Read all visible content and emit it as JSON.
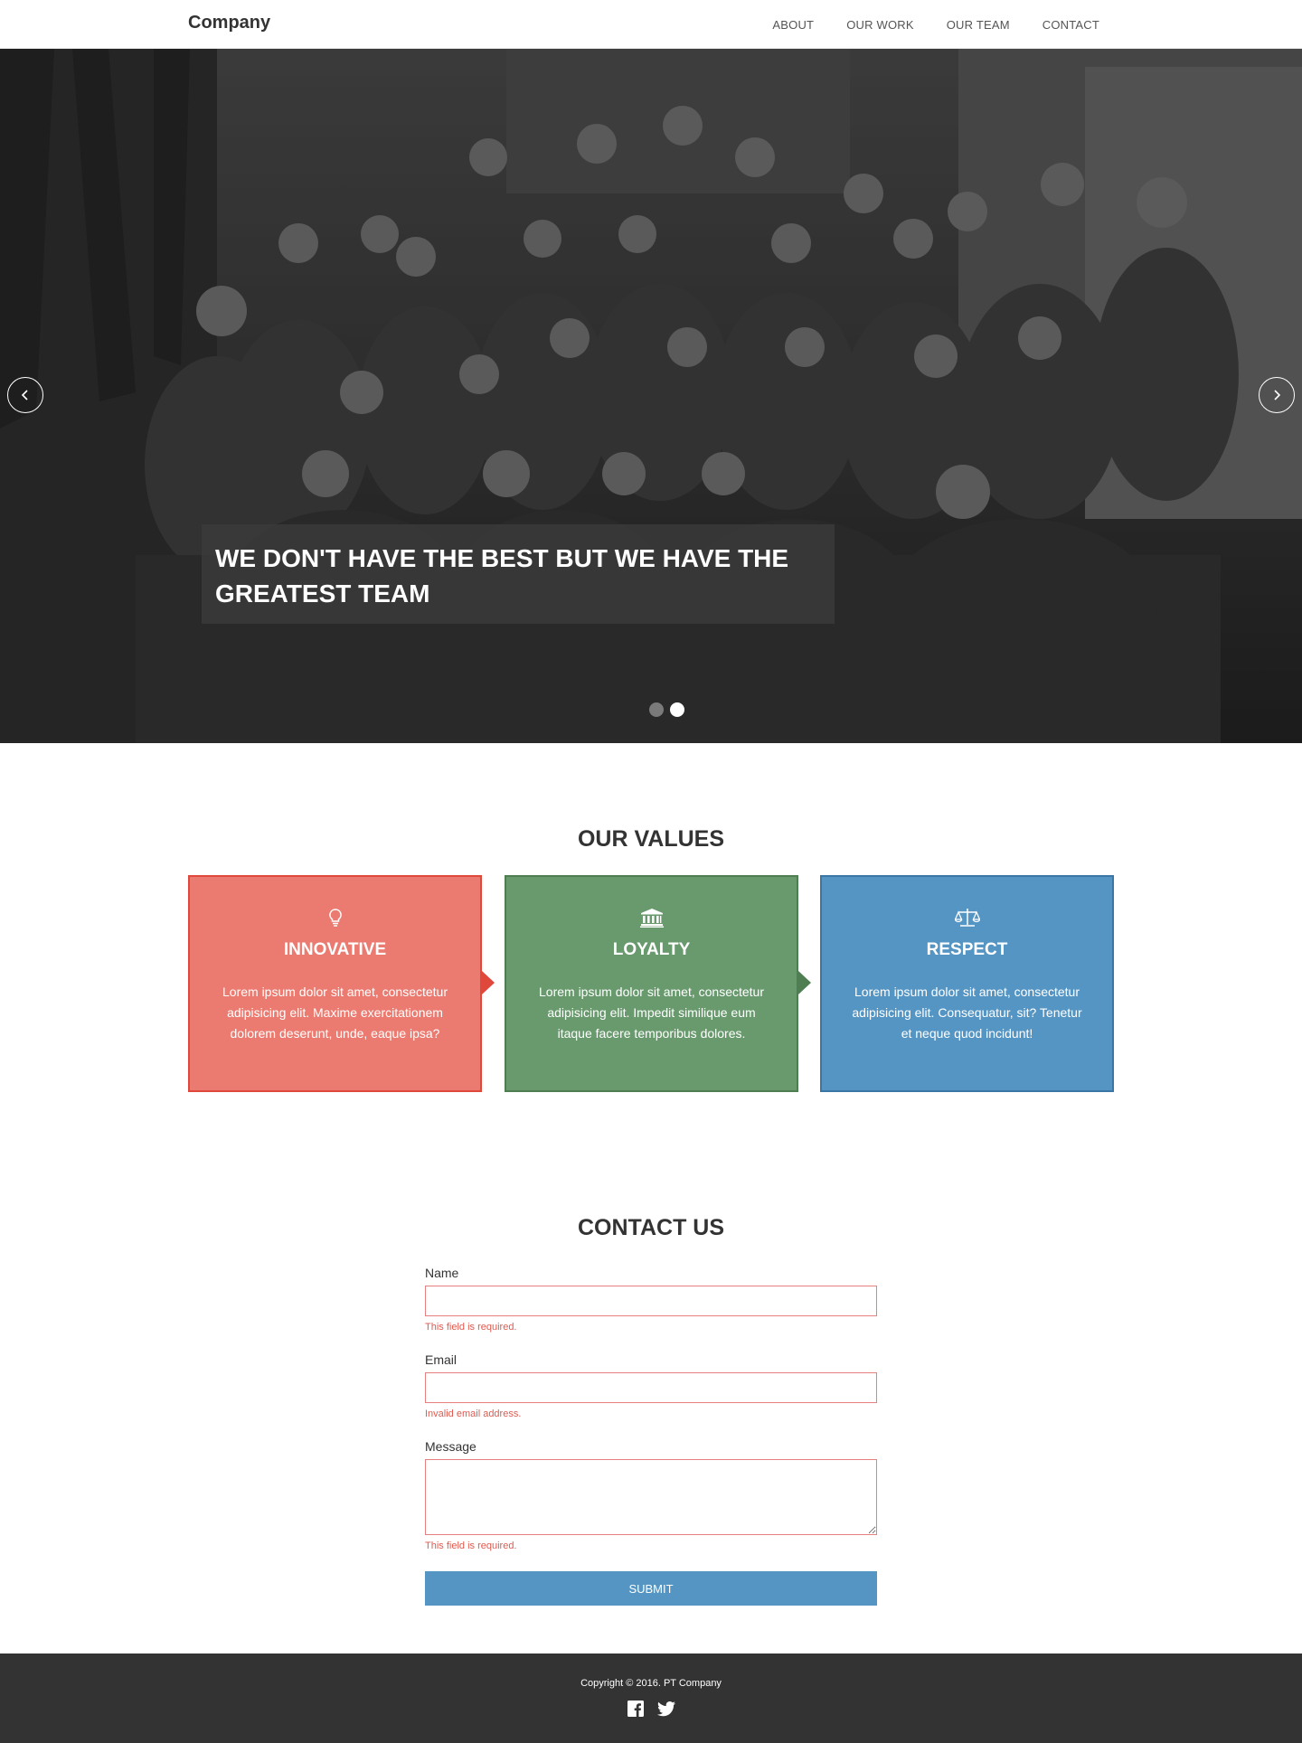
{
  "navbar": {
    "brand": "Company",
    "links": [
      {
        "label": "ABOUT"
      },
      {
        "label": "OUR WORK"
      },
      {
        "label": "OUR TEAM"
      },
      {
        "label": "CONTACT"
      }
    ]
  },
  "hero": {
    "caption": "WE DON'T HAVE THE BEST BUT WE HAVE THE GREATEST TEAM",
    "prev_icon": "chevron-left-icon",
    "next_icon": "chevron-right-icon",
    "slides_total": 2,
    "active_slide": 2
  },
  "values": {
    "title": "OUR VALUES",
    "cards": [
      {
        "icon": "lightbulb-icon",
        "title": "INNOVATIVE",
        "text": "Lorem ipsum dolor sit amet, consectetur adipisicing elit. Maxime exercitationem dolorem deserunt, unde, eaque ipsa?",
        "color": "#eb7b70"
      },
      {
        "icon": "bank-icon",
        "title": "LOYALTY",
        "text": "Lorem ipsum dolor sit amet, consectetur adipisicing elit. Impedit similique eum itaque facere temporibus dolores.",
        "color": "#699a6e"
      },
      {
        "icon": "balance-scale-icon",
        "title": "RESPECT",
        "text": "Lorem ipsum dolor sit amet, consectetur adipisicing elit. Consequatur, sit? Tenetur et neque quod incidunt!",
        "color": "#5495c4"
      }
    ]
  },
  "contact": {
    "title": "CONTACT US",
    "fields": {
      "name": {
        "label": "Name",
        "value": "",
        "error": "This field is required."
      },
      "email": {
        "label": "Email",
        "value": "",
        "error": "Invalid email address."
      },
      "message": {
        "label": "Message",
        "value": "",
        "error": "This field is required."
      }
    },
    "submit_label": "SUBMIT",
    "error_color": "#e05a4f"
  },
  "footer": {
    "copyright": "Copyright © 2016. PT Company",
    "social": [
      {
        "icon": "facebook-icon"
      },
      {
        "icon": "twitter-icon"
      }
    ]
  }
}
